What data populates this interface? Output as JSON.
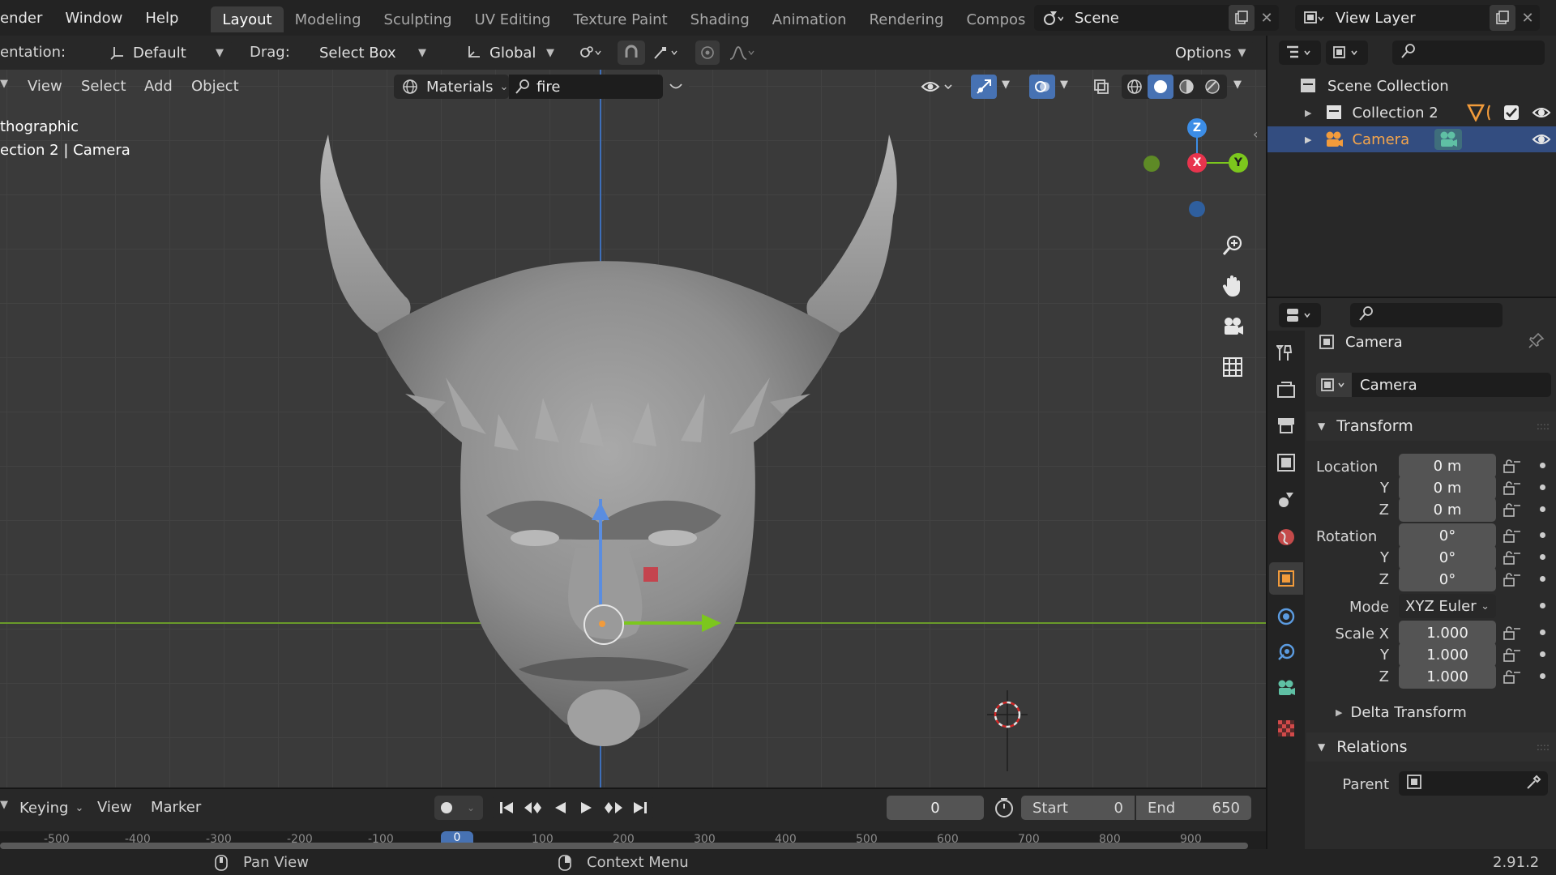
{
  "menu": [
    "ender",
    "Window",
    "Help"
  ],
  "workspace_tabs": [
    "Layout",
    "Modeling",
    "Sculpting",
    "UV Editing",
    "Texture Paint",
    "Shading",
    "Animation",
    "Rendering",
    "Compos"
  ],
  "scene": {
    "label": "Scene"
  },
  "view_layer": {
    "label": "View Layer"
  },
  "tool_header": {
    "orientation_label": "entation:",
    "orientation_value": "Default",
    "drag_label": "Drag:",
    "drag_value": "Select Box",
    "transform_value": "Global",
    "options_label": "Options"
  },
  "view_header": {
    "view": "View",
    "select": "Select",
    "add": "Add",
    "object": "Object",
    "materials": "Materials",
    "search_value": "fire"
  },
  "viewport": {
    "info_line1": "thographic",
    "info_line2": "ection 2 | Camera",
    "gizmo": {
      "z": "Z",
      "x": "X",
      "y": "Y"
    }
  },
  "outliner": {
    "items": [
      {
        "label": "Scene Collection"
      },
      {
        "label": "Collection 2"
      },
      {
        "label": "Camera"
      }
    ]
  },
  "properties": {
    "object_name": "Camera",
    "name_field": "Camera",
    "transform_label": "Transform",
    "location_label": "Location",
    "location": [
      "0 m",
      "0 m",
      "0 m"
    ],
    "rotation_label": "Rotation",
    "rotation": [
      "0°",
      "0°",
      "0°"
    ],
    "mode_label": "Mode",
    "mode_value": "XYZ Euler",
    "scale_label": "Scale X",
    "scale": [
      "1.000",
      "1.000",
      "1.000"
    ],
    "axis_y": "Y",
    "axis_z": "Z",
    "delta_label": "Delta Transform",
    "relations_label": "Relations",
    "parent_label": "Parent"
  },
  "timeline": {
    "keying": "Keying",
    "view": "View",
    "marker": "Marker",
    "current_frame": "0",
    "start_label": "Start",
    "start_value": "0",
    "end_label": "End",
    "end_value": "650",
    "ruler": [
      "-500",
      "-400",
      "-300",
      "-200",
      "-100",
      "0",
      "100",
      "200",
      "300",
      "400",
      "500",
      "600",
      "700",
      "800",
      "900"
    ]
  },
  "statusbar": {
    "pan": "Pan View",
    "context": "Context Menu",
    "version": "2.91.2"
  },
  "colors": {
    "accent": "#4772b3",
    "x_axis": "#e8344d",
    "y_axis": "#7cc71d",
    "z_axis": "#3c8de6",
    "selected_orange": "#f29b3b"
  }
}
